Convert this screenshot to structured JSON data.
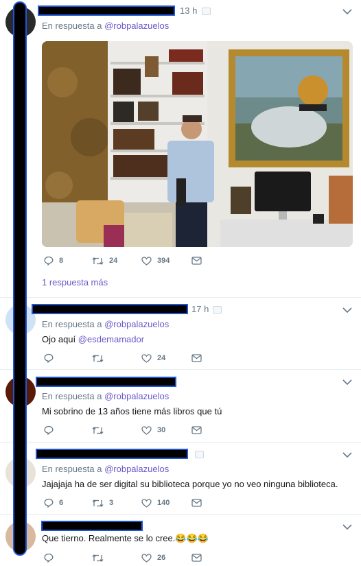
{
  "tweets": [
    {
      "time": "13 h",
      "reply_prefix": "En respuesta a",
      "reply_handle": "@robpalazuelos",
      "stats": {
        "replies": "8",
        "retweets": "24",
        "likes": "394"
      }
    },
    {
      "time": "17 h",
      "reply_prefix": "En respuesta a",
      "reply_handle": "@robpalazuelos",
      "text_prefix": "Ojo aquí",
      "text_handle": "@esdemamador",
      "stats": {
        "replies": "",
        "retweets": "",
        "likes": "24"
      }
    },
    {
      "reply_prefix": "En respuesta a",
      "reply_handle": "@robpalazuelos",
      "text": "Mi sobrino de 13 años tiene más libros que tú",
      "stats": {
        "replies": "",
        "retweets": "",
        "likes": "30"
      }
    },
    {
      "reply_prefix": "En respuesta a",
      "reply_handle": "@robpalazuelos",
      "text": "Jajajaja ha de ser digital su biblioteca porque yo no veo ninguna biblioteca.",
      "stats": {
        "replies": "6",
        "retweets": "3",
        "likes": "140"
      }
    },
    {
      "text": "Que tierno. Realmente se lo cree.😂😂😂",
      "stats": {
        "replies": "",
        "retweets": "",
        "likes": "26"
      }
    }
  ],
  "more_replies": "1 respuesta más",
  "icons": {
    "reply": "reply-icon",
    "retweet": "retweet-icon",
    "like": "heart-icon",
    "dm": "envelope-icon",
    "menu": "chevron-down-icon"
  },
  "colors": {
    "link": "#6a59c9",
    "muted": "#657786",
    "redaction": "#000000",
    "redaction_border": "#1f56d8"
  }
}
